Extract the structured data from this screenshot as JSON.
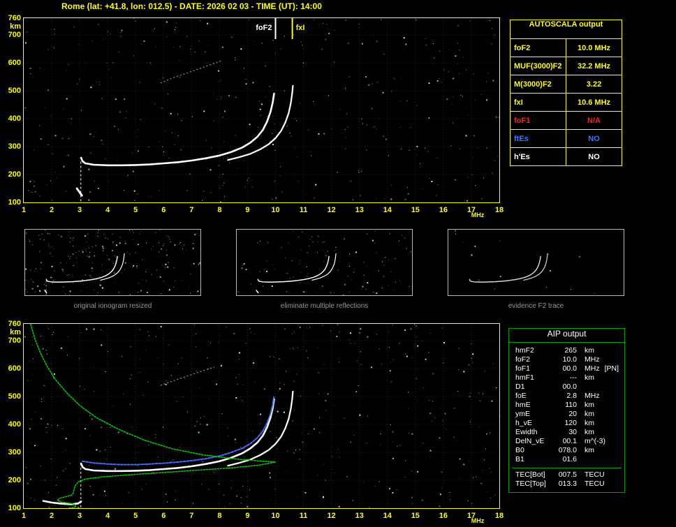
{
  "header": {
    "title": "Rome (lat: +41.8, lon: 012.5) - DATE: 2026 02 03 - TIME (UT): 14:00"
  },
  "colors": {
    "accent_yellow": "#ffff00",
    "trace_white": "#ffffff",
    "profile_green": "#00cc00",
    "restored_blue": "#4668ff",
    "na_red": "#ff2020",
    "es_blue": "#2f7bff",
    "caption_gray": "#989898",
    "table_green": "#00a000",
    "grid_gray": "#2a2a2a"
  },
  "autoscala_table": {
    "title": "AUTOSCALA output",
    "rows": [
      {
        "label": "foF2",
        "value": "10.0 MHz",
        "color": "#ffff00"
      },
      {
        "label": "MUF(3000)F2",
        "value": "32.2 MHz",
        "color": "#ffff00"
      },
      {
        "label": "M(3000)F2",
        "value": "3.22",
        "color": "#ffff00"
      },
      {
        "label": "fxI",
        "value": "10.6 MHz",
        "color": "#ffff00"
      },
      {
        "label": "foF1",
        "value": "N/A",
        "color": "#ff2020"
      },
      {
        "label": "ftEs",
        "value": "NO",
        "color": "#2f7bff"
      },
      {
        "label": "h'Es",
        "value": "NO",
        "color": "#ffffff"
      }
    ]
  },
  "aip_table": {
    "title": "AIP output",
    "rows": [
      {
        "label": "hmF2",
        "value": "265",
        "unit": "km",
        "extra": ""
      },
      {
        "label": "foF2",
        "value": "10.0",
        "unit": "MHz",
        "extra": ""
      },
      {
        "label": "foF1",
        "value": "00.0",
        "unit": "MHz",
        "extra": "[PN]"
      },
      {
        "label": "hmF1",
        "value": "---",
        "unit": "km",
        "extra": ""
      },
      {
        "label": "D1",
        "value": "00.0",
        "unit": "",
        "extra": ""
      },
      {
        "label": "foE",
        "value": "2.8",
        "unit": "MHz",
        "extra": ""
      },
      {
        "label": "hmE",
        "value": "110",
        "unit": "km",
        "extra": ""
      },
      {
        "label": "ymE",
        "value": "20",
        "unit": "km",
        "extra": ""
      },
      {
        "label": "h_vE",
        "value": "120",
        "unit": "km",
        "extra": ""
      },
      {
        "label": "Ewidth",
        "value": "30",
        "unit": "km",
        "extra": ""
      },
      {
        "label": "DelN_vE",
        "value": "00.1",
        "unit": "m^(-3)",
        "extra": ""
      },
      {
        "label": "B0",
        "value": "078.0",
        "unit": "km",
        "extra": ""
      },
      {
        "label": "B1",
        "value": "01.6",
        "unit": "",
        "extra": ""
      }
    ],
    "tec_rows": [
      {
        "label": "TEC[Bot]",
        "value": "007.5",
        "unit": "TECU"
      },
      {
        "label": "TEC[Top]",
        "value": "013.3",
        "unit": "TECU"
      }
    ]
  },
  "thumbnails": [
    {
      "caption": "original ionogram resized",
      "series": [
        "F2-O-trace",
        "F2-X-trace",
        "E-region-echo",
        "interference-column",
        "second-hop"
      ],
      "noise_count": 240,
      "seed": 5,
      "trace_color": ""
    },
    {
      "caption": "eliminate multiple reflections",
      "series": [
        "F2-O-trace",
        "F2-X-trace",
        "E-region-echo"
      ],
      "noise_count": 110,
      "seed": 9,
      "trace_color": ""
    },
    {
      "caption": "evidence F2 trace",
      "series": [
        "F2-O-trace",
        "F2-X-trace"
      ],
      "noise_count": 18,
      "seed": 13,
      "trace_color": "#d8d8d8"
    }
  ],
  "chart_data": [
    {
      "id": "top_ionogram",
      "type": "scatter",
      "title": "Autoscaled ionogram (virtual height vs frequency) with foF2 and fxI markers",
      "xlabel": "MHz",
      "ylabel": "km",
      "xlim": [
        1,
        18
      ],
      "ylim": [
        100,
        760
      ],
      "xticks": [
        1,
        2,
        3,
        4,
        5,
        6,
        7,
        8,
        9,
        10,
        11,
        12,
        13,
        14,
        15,
        16,
        17,
        18
      ],
      "yticks": [
        100,
        200,
        300,
        400,
        500,
        600,
        700,
        760
      ],
      "grid": true,
      "noise": {
        "count": 420,
        "seed": 11
      },
      "annotations": [
        {
          "label": "foF2",
          "x": 10.0,
          "color": "#ffffff",
          "side": "left"
        },
        {
          "label": "fxI",
          "x": 10.6,
          "color": "#ffff00",
          "side": "right"
        }
      ],
      "series": [
        {
          "name": "second-hop",
          "color": "#aaaaaa",
          "width": 1.3,
          "dash": "1,4",
          "opacity": 0.8,
          "points": [
            [
              5.9,
              528
            ],
            [
              6.3,
              545
            ],
            [
              6.8,
              562
            ],
            [
              7.3,
              580
            ],
            [
              7.8,
              598
            ],
            [
              8.1,
              608
            ]
          ]
        },
        {
          "name": "interference-column",
          "color": "#cccccc",
          "width": 1.5,
          "dash": "2,4",
          "opacity": 0.85,
          "points": [
            [
              3.04,
              105
            ],
            [
              3.04,
              255
            ]
          ]
        },
        {
          "name": "E-region-echo",
          "color": "#ffffff",
          "width": 2.8,
          "points": [
            [
              2.9,
              150
            ],
            [
              3.0,
              136
            ],
            [
              3.08,
              125
            ]
          ]
        },
        {
          "name": "F2-O-trace",
          "color": "#ffffff",
          "width": 2.6,
          "points": [
            [
              3.05,
              260
            ],
            [
              3.1,
              248
            ],
            [
              3.2,
              240
            ],
            [
              3.5,
              235
            ],
            [
              4.0,
              233
            ],
            [
              4.5,
              233
            ],
            [
              5.0,
              234
            ],
            [
              5.5,
              236
            ],
            [
              6.0,
              240
            ],
            [
              6.5,
              244
            ],
            [
              7.0,
              250
            ],
            [
              7.5,
              258
            ],
            [
              8.0,
              268
            ],
            [
              8.4,
              280
            ],
            [
              8.8,
              296
            ],
            [
              9.1,
              314
            ],
            [
              9.35,
              335
            ],
            [
              9.55,
              360
            ],
            [
              9.7,
              390
            ],
            [
              9.82,
              424
            ],
            [
              9.9,
              458
            ],
            [
              9.95,
              490
            ]
          ]
        },
        {
          "name": "F2-X-trace",
          "color": "#ffffff",
          "width": 2.2,
          "points": [
            [
              8.3,
              252
            ],
            [
              8.7,
              262
            ],
            [
              9.1,
              274
            ],
            [
              9.45,
              290
            ],
            [
              9.75,
              308
            ],
            [
              10.0,
              330
            ],
            [
              10.2,
              356
            ],
            [
              10.35,
              386
            ],
            [
              10.47,
              420
            ],
            [
              10.55,
              458
            ],
            [
              10.6,
              495
            ],
            [
              10.62,
              518
            ]
          ]
        }
      ]
    },
    {
      "id": "bottom_ionogram",
      "type": "scatter",
      "title": "Ionogram with restored trace (blue) and electron density profile (green)",
      "xlabel": "MHz",
      "ylabel": "km",
      "xlim": [
        1,
        18
      ],
      "ylim": [
        100,
        760
      ],
      "xticks": [
        1,
        2,
        3,
        4,
        5,
        6,
        7,
        8,
        9,
        10,
        11,
        12,
        13,
        14,
        15,
        16,
        17,
        18
      ],
      "yticks": [
        100,
        200,
        300,
        400,
        500,
        600,
        700,
        760
      ],
      "grid": true,
      "noise": {
        "count": 470,
        "seed": 23
      },
      "annotations": [],
      "series": [
        {
          "name": "second-hop",
          "color": "#aaaaaa",
          "width": 1.3,
          "dash": "1,4",
          "opacity": 0.8,
          "points": [
            [
              5.9,
              540
            ],
            [
              6.4,
              558
            ],
            [
              6.9,
              575
            ],
            [
              7.4,
              592
            ],
            [
              7.8,
              605
            ]
          ]
        },
        {
          "name": "interference-column",
          "color": "#cccccc",
          "width": 1.5,
          "dash": "2,4",
          "opacity": 0.85,
          "points": [
            [
              3.04,
              104
            ],
            [
              3.04,
              262
            ]
          ]
        },
        {
          "name": "F2-O-trace",
          "color": "#ffffff",
          "width": 2.6,
          "points": [
            [
              3.05,
              260
            ],
            [
              3.1,
              248
            ],
            [
              3.2,
              240
            ],
            [
              3.5,
              235
            ],
            [
              4.0,
              233
            ],
            [
              4.5,
              233
            ],
            [
              5.0,
              234
            ],
            [
              5.5,
              236
            ],
            [
              6.0,
              240
            ],
            [
              6.5,
              244
            ],
            [
              7.0,
              250
            ],
            [
              7.5,
              258
            ],
            [
              8.0,
              268
            ],
            [
              8.4,
              280
            ],
            [
              8.8,
              296
            ],
            [
              9.1,
              314
            ],
            [
              9.35,
              335
            ],
            [
              9.55,
              360
            ],
            [
              9.7,
              390
            ],
            [
              9.82,
              424
            ],
            [
              9.9,
              458
            ],
            [
              9.95,
              490
            ]
          ]
        },
        {
          "name": "F2-X-trace",
          "color": "#ffffff",
          "width": 2.2,
          "points": [
            [
              8.3,
              252
            ],
            [
              8.7,
              262
            ],
            [
              9.1,
              274
            ],
            [
              9.45,
              290
            ],
            [
              9.75,
              308
            ],
            [
              10.0,
              330
            ],
            [
              10.2,
              356
            ],
            [
              10.35,
              386
            ],
            [
              10.47,
              420
            ],
            [
              10.55,
              458
            ],
            [
              10.6,
              495
            ],
            [
              10.62,
              518
            ]
          ]
        },
        {
          "name": "E-region-echo",
          "color": "#ffffff",
          "width": 2.6,
          "points": [
            [
              1.7,
              126
            ],
            [
              2.0,
              120
            ],
            [
              2.35,
              116
            ],
            [
              2.7,
              114
            ],
            [
              2.95,
              117
            ],
            [
              3.05,
              124
            ]
          ]
        },
        {
          "name": "restored-trace",
          "color": "#4668ff",
          "width": 2.0,
          "dash": "3,2",
          "points": [
            [
              3.1,
              268
            ],
            [
              3.5,
              262
            ],
            [
              4.0,
              258
            ],
            [
              4.5,
              256
            ],
            [
              5.0,
              256
            ],
            [
              5.5,
              258
            ],
            [
              6.0,
              261
            ],
            [
              6.5,
              265
            ],
            [
              7.0,
              270
            ],
            [
              7.5,
              277
            ],
            [
              8.0,
              287
            ],
            [
              8.4,
              299
            ],
            [
              8.8,
              314
            ],
            [
              9.1,
              331
            ],
            [
              9.35,
              352
            ],
            [
              9.55,
              377
            ],
            [
              9.7,
              406
            ],
            [
              9.82,
              438
            ],
            [
              9.9,
              470
            ],
            [
              9.94,
              498
            ]
          ]
        },
        {
          "name": "electron-density-profile",
          "color": "#00cc00",
          "width": 1.6,
          "dash": "2,2",
          "points": [
            [
              1.25,
              758
            ],
            [
              1.4,
              706
            ],
            [
              1.6,
              655
            ],
            [
              1.85,
              605
            ],
            [
              2.15,
              558
            ],
            [
              2.55,
              512
            ],
            [
              3.0,
              468
            ],
            [
              3.6,
              424
            ],
            [
              4.4,
              382
            ],
            [
              5.3,
              344
            ],
            [
              6.3,
              313
            ],
            [
              7.4,
              291
            ],
            [
              8.6,
              276
            ],
            [
              9.6,
              268
            ],
            [
              10.0,
              265
            ],
            [
              9.4,
              254
            ],
            [
              8.4,
              244
            ],
            [
              7.2,
              236
            ],
            [
              5.9,
              227
            ],
            [
              4.7,
              219
            ],
            [
              3.8,
              212
            ],
            [
              3.2,
              204
            ],
            [
              2.95,
              194
            ],
            [
              2.85,
              182
            ],
            [
              2.8,
              168
            ],
            [
              2.77,
              154
            ],
            [
              2.7,
              146
            ],
            [
              2.5,
              141
            ],
            [
              2.3,
              136
            ],
            [
              2.2,
              129
            ],
            [
              2.3,
              123
            ],
            [
              2.55,
              119
            ],
            [
              2.8,
              115
            ],
            [
              2.87,
              108
            ],
            [
              2.78,
              102
            ],
            [
              2.6,
              100
            ]
          ]
        }
      ]
    }
  ]
}
